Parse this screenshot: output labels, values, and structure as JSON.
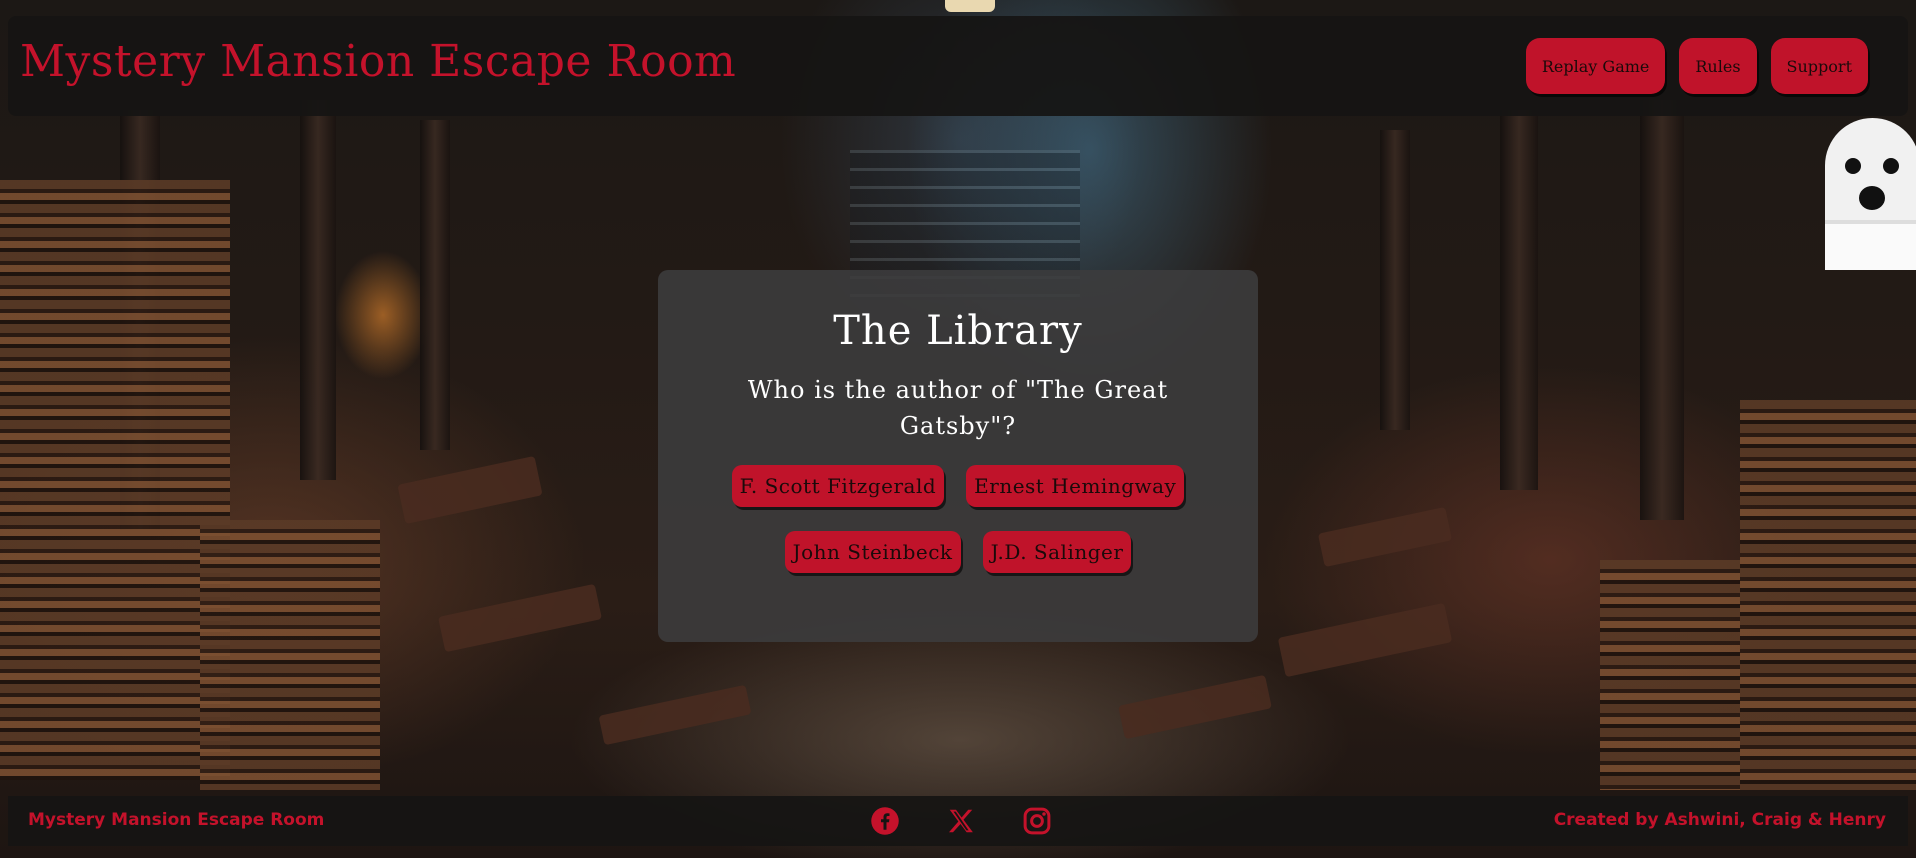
{
  "header": {
    "title": "Mystery Mansion Escape Room",
    "nav": [
      "Replay Game",
      "Rules",
      "Support"
    ]
  },
  "room": {
    "title": "The Library",
    "question": "Who is the author of \"The Great Gatsby\"?",
    "answers": [
      "F. Scott Fitzgerald",
      "Ernest Hemingway",
      "John Steinbeck",
      "J.D. Salinger"
    ]
  },
  "footer": {
    "left": "Mystery Mansion Escape Room",
    "right": "Created by Ashwini, Craig & Henry",
    "social_icons": [
      "facebook-icon",
      "x-icon",
      "instagram-icon"
    ]
  },
  "colors": {
    "accent": "#c0132a",
    "panel": "#161413",
    "card": "#3c3c3e",
    "text_light": "#ffffff"
  }
}
